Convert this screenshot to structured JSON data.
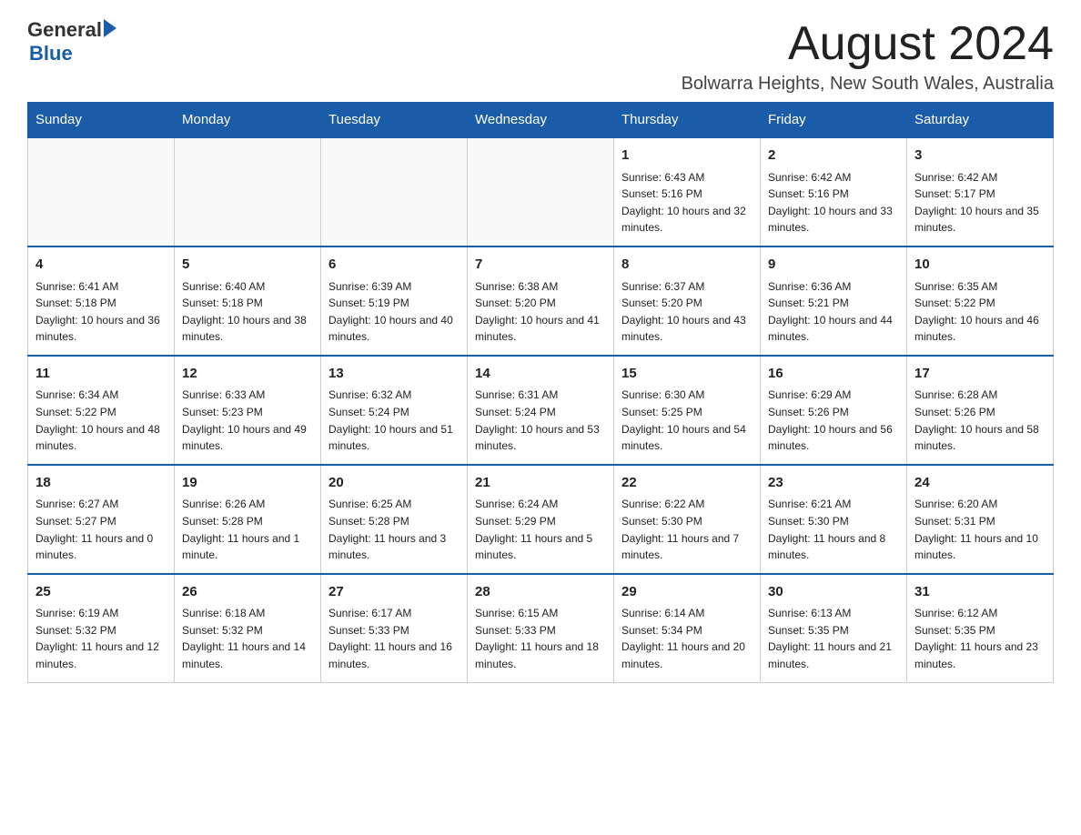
{
  "logo": {
    "general": "General",
    "arrow": "▶",
    "blue": "Blue"
  },
  "title": {
    "month": "August 2024",
    "location": "Bolwarra Heights, New South Wales, Australia"
  },
  "headers": [
    "Sunday",
    "Monday",
    "Tuesday",
    "Wednesday",
    "Thursday",
    "Friday",
    "Saturday"
  ],
  "weeks": [
    [
      {
        "day": "",
        "sunrise": "",
        "sunset": "",
        "daylight": ""
      },
      {
        "day": "",
        "sunrise": "",
        "sunset": "",
        "daylight": ""
      },
      {
        "day": "",
        "sunrise": "",
        "sunset": "",
        "daylight": ""
      },
      {
        "day": "",
        "sunrise": "",
        "sunset": "",
        "daylight": ""
      },
      {
        "day": "1",
        "sunrise": "Sunrise: 6:43 AM",
        "sunset": "Sunset: 5:16 PM",
        "daylight": "Daylight: 10 hours and 32 minutes."
      },
      {
        "day": "2",
        "sunrise": "Sunrise: 6:42 AM",
        "sunset": "Sunset: 5:16 PM",
        "daylight": "Daylight: 10 hours and 33 minutes."
      },
      {
        "day": "3",
        "sunrise": "Sunrise: 6:42 AM",
        "sunset": "Sunset: 5:17 PM",
        "daylight": "Daylight: 10 hours and 35 minutes."
      }
    ],
    [
      {
        "day": "4",
        "sunrise": "Sunrise: 6:41 AM",
        "sunset": "Sunset: 5:18 PM",
        "daylight": "Daylight: 10 hours and 36 minutes."
      },
      {
        "day": "5",
        "sunrise": "Sunrise: 6:40 AM",
        "sunset": "Sunset: 5:18 PM",
        "daylight": "Daylight: 10 hours and 38 minutes."
      },
      {
        "day": "6",
        "sunrise": "Sunrise: 6:39 AM",
        "sunset": "Sunset: 5:19 PM",
        "daylight": "Daylight: 10 hours and 40 minutes."
      },
      {
        "day": "7",
        "sunrise": "Sunrise: 6:38 AM",
        "sunset": "Sunset: 5:20 PM",
        "daylight": "Daylight: 10 hours and 41 minutes."
      },
      {
        "day": "8",
        "sunrise": "Sunrise: 6:37 AM",
        "sunset": "Sunset: 5:20 PM",
        "daylight": "Daylight: 10 hours and 43 minutes."
      },
      {
        "day": "9",
        "sunrise": "Sunrise: 6:36 AM",
        "sunset": "Sunset: 5:21 PM",
        "daylight": "Daylight: 10 hours and 44 minutes."
      },
      {
        "day": "10",
        "sunrise": "Sunrise: 6:35 AM",
        "sunset": "Sunset: 5:22 PM",
        "daylight": "Daylight: 10 hours and 46 minutes."
      }
    ],
    [
      {
        "day": "11",
        "sunrise": "Sunrise: 6:34 AM",
        "sunset": "Sunset: 5:22 PM",
        "daylight": "Daylight: 10 hours and 48 minutes."
      },
      {
        "day": "12",
        "sunrise": "Sunrise: 6:33 AM",
        "sunset": "Sunset: 5:23 PM",
        "daylight": "Daylight: 10 hours and 49 minutes."
      },
      {
        "day": "13",
        "sunrise": "Sunrise: 6:32 AM",
        "sunset": "Sunset: 5:24 PM",
        "daylight": "Daylight: 10 hours and 51 minutes."
      },
      {
        "day": "14",
        "sunrise": "Sunrise: 6:31 AM",
        "sunset": "Sunset: 5:24 PM",
        "daylight": "Daylight: 10 hours and 53 minutes."
      },
      {
        "day": "15",
        "sunrise": "Sunrise: 6:30 AM",
        "sunset": "Sunset: 5:25 PM",
        "daylight": "Daylight: 10 hours and 54 minutes."
      },
      {
        "day": "16",
        "sunrise": "Sunrise: 6:29 AM",
        "sunset": "Sunset: 5:26 PM",
        "daylight": "Daylight: 10 hours and 56 minutes."
      },
      {
        "day": "17",
        "sunrise": "Sunrise: 6:28 AM",
        "sunset": "Sunset: 5:26 PM",
        "daylight": "Daylight: 10 hours and 58 minutes."
      }
    ],
    [
      {
        "day": "18",
        "sunrise": "Sunrise: 6:27 AM",
        "sunset": "Sunset: 5:27 PM",
        "daylight": "Daylight: 11 hours and 0 minutes."
      },
      {
        "day": "19",
        "sunrise": "Sunrise: 6:26 AM",
        "sunset": "Sunset: 5:28 PM",
        "daylight": "Daylight: 11 hours and 1 minute."
      },
      {
        "day": "20",
        "sunrise": "Sunrise: 6:25 AM",
        "sunset": "Sunset: 5:28 PM",
        "daylight": "Daylight: 11 hours and 3 minutes."
      },
      {
        "day": "21",
        "sunrise": "Sunrise: 6:24 AM",
        "sunset": "Sunset: 5:29 PM",
        "daylight": "Daylight: 11 hours and 5 minutes."
      },
      {
        "day": "22",
        "sunrise": "Sunrise: 6:22 AM",
        "sunset": "Sunset: 5:30 PM",
        "daylight": "Daylight: 11 hours and 7 minutes."
      },
      {
        "day": "23",
        "sunrise": "Sunrise: 6:21 AM",
        "sunset": "Sunset: 5:30 PM",
        "daylight": "Daylight: 11 hours and 8 minutes."
      },
      {
        "day": "24",
        "sunrise": "Sunrise: 6:20 AM",
        "sunset": "Sunset: 5:31 PM",
        "daylight": "Daylight: 11 hours and 10 minutes."
      }
    ],
    [
      {
        "day": "25",
        "sunrise": "Sunrise: 6:19 AM",
        "sunset": "Sunset: 5:32 PM",
        "daylight": "Daylight: 11 hours and 12 minutes."
      },
      {
        "day": "26",
        "sunrise": "Sunrise: 6:18 AM",
        "sunset": "Sunset: 5:32 PM",
        "daylight": "Daylight: 11 hours and 14 minutes."
      },
      {
        "day": "27",
        "sunrise": "Sunrise: 6:17 AM",
        "sunset": "Sunset: 5:33 PM",
        "daylight": "Daylight: 11 hours and 16 minutes."
      },
      {
        "day": "28",
        "sunrise": "Sunrise: 6:15 AM",
        "sunset": "Sunset: 5:33 PM",
        "daylight": "Daylight: 11 hours and 18 minutes."
      },
      {
        "day": "29",
        "sunrise": "Sunrise: 6:14 AM",
        "sunset": "Sunset: 5:34 PM",
        "daylight": "Daylight: 11 hours and 20 minutes."
      },
      {
        "day": "30",
        "sunrise": "Sunrise: 6:13 AM",
        "sunset": "Sunset: 5:35 PM",
        "daylight": "Daylight: 11 hours and 21 minutes."
      },
      {
        "day": "31",
        "sunrise": "Sunrise: 6:12 AM",
        "sunset": "Sunset: 5:35 PM",
        "daylight": "Daylight: 11 hours and 23 minutes."
      }
    ]
  ]
}
